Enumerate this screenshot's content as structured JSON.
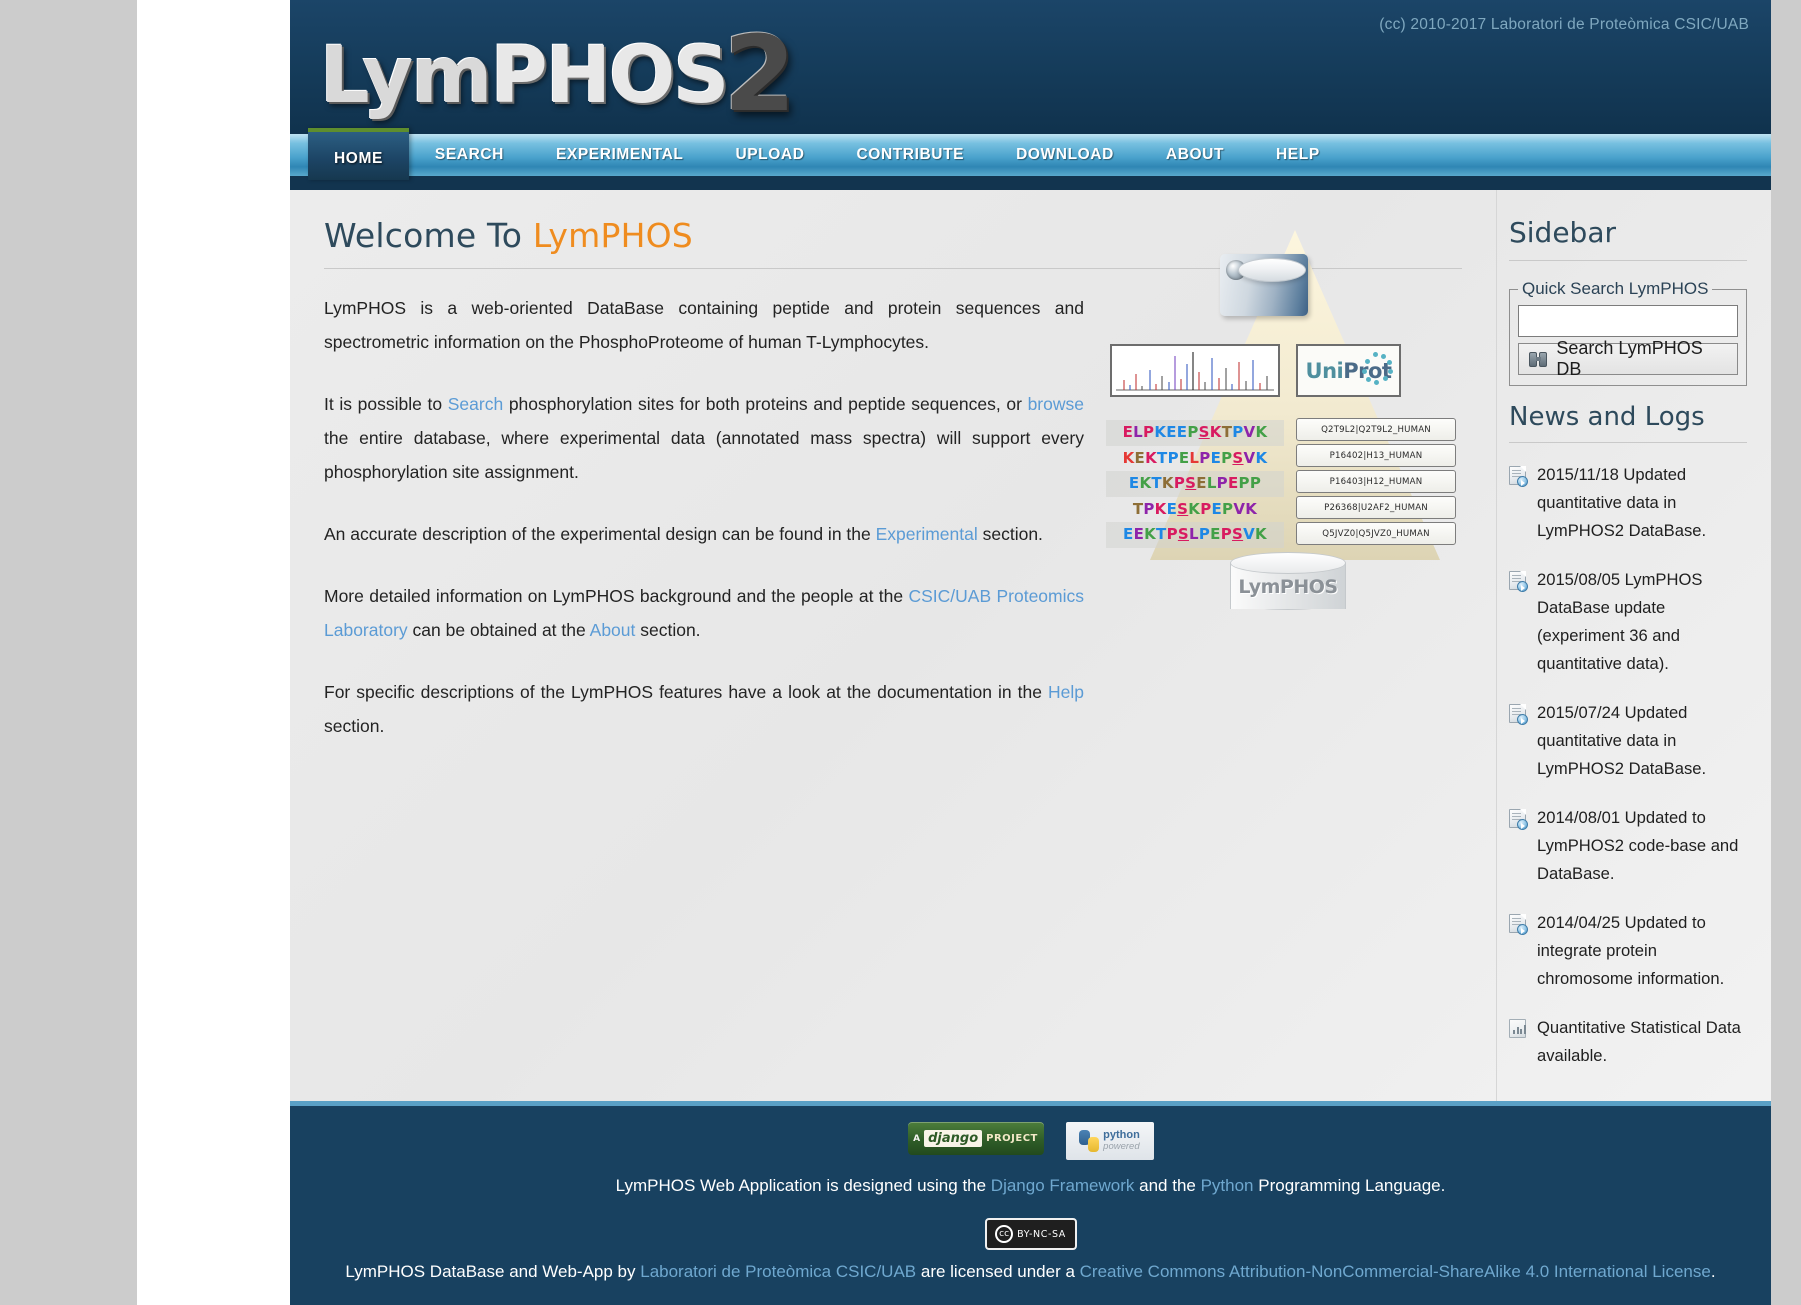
{
  "header": {
    "logo": {
      "part1": "Lym",
      "part2": "PHOS",
      "part3": "2"
    },
    "copyright": "(cc) 2010-2017 Laboratori de Proteòmica CSIC/UAB"
  },
  "nav": {
    "items": [
      {
        "label": "HOME",
        "active": true
      },
      {
        "label": "SEARCH",
        "active": false
      },
      {
        "label": "EXPERIMENTAL",
        "active": false
      },
      {
        "label": "UPLOAD",
        "active": false
      },
      {
        "label": "CONTRIBUTE",
        "active": false
      },
      {
        "label": "DOWNLOAD",
        "active": false
      },
      {
        "label": "ABOUT",
        "active": false
      },
      {
        "label": "HELP",
        "active": false
      }
    ]
  },
  "main": {
    "title_plain": "Welcome To ",
    "title_accent": "LymPHOS",
    "paragraphs": {
      "p1": "LymPHOS is a web-oriented DataBase containing peptide and protein sequences and spectrometric information on the PhosphoProteome of human T-Lymphocytes.",
      "p2_a": "It is possible to ",
      "p2_link1": "Search",
      "p2_b": " phosphorylation sites for both proteins and peptide sequences, or ",
      "p2_link2": "browse",
      "p2_c": " the entire database, where experimental data (annotated mass spectra) will support every phosphorylation site assignment.",
      "p3_a": "An accurate description of the experimental design can be found in the ",
      "p3_link": "Experimental",
      "p3_b": " section.",
      "p4_a": "More detailed information on LymPHOS background and the people at the ",
      "p4_link": "CSIC/UAB Proteomics Laboratory",
      "p4_b": " can be obtained at the ",
      "p4_link2": "About",
      "p4_c": " section.",
      "p5_a": "For specific descriptions of the LymPHOS features have a look at the documentation in the ",
      "p5_link": "Help",
      "p5_b": " section."
    },
    "graphic": {
      "uniprot_1": "Uni",
      "uniprot_2": "Prot",
      "database_label": "LymPHOS",
      "peptides": [
        "ELPKEEPSKTPVK",
        "KEKTPELPEPSVK",
        "EKTKPSELPEPP",
        "TPKESKPEPVK",
        "EEKTPSLPEPSVK"
      ],
      "accessions": [
        "Q2T9L2|Q2T9L2_HUMAN",
        "P16402|H13_HUMAN",
        "P16403|H12_HUMAN",
        "P26368|U2AF2_HUMAN",
        "Q5JVZ0|Q5JVZ0_HUMAN"
      ]
    }
  },
  "sidebar": {
    "title": "Sidebar",
    "quick_search": {
      "legend": "Quick Search LymPHOS",
      "input_value": "",
      "input_placeholder": "",
      "button_label": "Search LymPHOS DB"
    },
    "news": {
      "heading": "News and Logs",
      "items": [
        {
          "text": "2015/11/18 Updated quantitative data in LymPHOS2 DataBase.",
          "icon": "document-refresh-icon"
        },
        {
          "text": "2015/08/05 LymPHOS DataBase update (experiment 36 and quantitative data).",
          "icon": "document-refresh-icon"
        },
        {
          "text": "2015/07/24 Updated quantitative data in LymPHOS2 DataBase.",
          "icon": "document-refresh-icon"
        },
        {
          "text": "2014/08/01 Updated to LymPHOS2 code-base and DataBase.",
          "icon": "document-refresh-icon"
        },
        {
          "text": "2014/04/25 Updated to integrate protein chromosome information.",
          "icon": "document-refresh-icon"
        },
        {
          "text": "Quantitative Statistical Data available.",
          "icon": "document-chart-icon"
        }
      ]
    }
  },
  "footer": {
    "django_badge": {
      "a": "A",
      "name": "django",
      "project": "PROJECT"
    },
    "python_badge": {
      "name": "python",
      "tagline": "powered"
    },
    "line1_a": "LymPHOS Web Application is designed using the ",
    "line1_link1": "Django Framework",
    "line1_b": " and the ",
    "line1_link2": "Python",
    "line1_c": " Programming Language.",
    "cc_badge": {
      "mark": "cc",
      "terms": "BY-NC-SA"
    },
    "line2_a": "LymPHOS DataBase and Web-App by ",
    "line2_link1": "Laboratori de Proteòmica CSIC/UAB",
    "line2_b": " are licensed under a ",
    "line2_link2": "Creative Commons Attribution-NonCommercial-ShareAlike 4.0 International License",
    "line2_c": "."
  },
  "colors": {
    "header_bg": "#184160",
    "nav_active_border": "#5e8e2e",
    "accent_orange": "#ef8c1f",
    "link_blue": "#5b9bd5",
    "heading_slate": "#2e4a5c",
    "page_bg": "#cccccc",
    "body_bg": "#ebebeb"
  }
}
